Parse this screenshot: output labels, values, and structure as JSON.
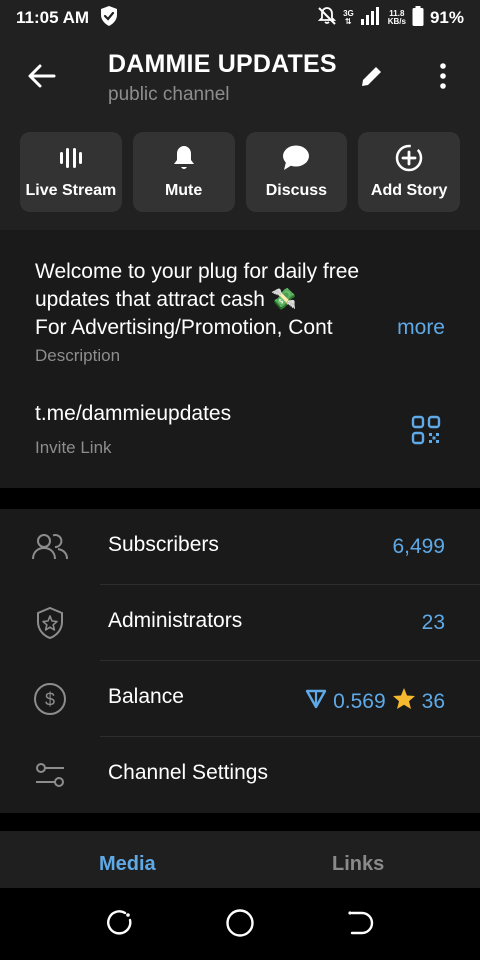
{
  "status_bar": {
    "time": "11:05 AM",
    "network": "3G",
    "speed_value": "11.8",
    "speed_unit": "KB/s",
    "battery": "91%"
  },
  "header": {
    "title": "DAMMIE UPDATES",
    "subtitle": "public channel"
  },
  "actions": [
    {
      "label": "Live Stream",
      "icon": "live-stream-icon"
    },
    {
      "label": "Mute",
      "icon": "bell-icon"
    },
    {
      "label": "Discuss",
      "icon": "chat-bubble-icon"
    },
    {
      "label": "Add Story",
      "icon": "add-story-icon"
    }
  ],
  "info": {
    "description_line1": "Welcome to your plug for daily free",
    "description_line2": "updates that attract cash 💸",
    "description_line3": "For Advertising/Promotion, Cont",
    "more": "more",
    "description_label": "Description",
    "link": "t.me/dammieupdates",
    "link_label": "Invite Link"
  },
  "rows": [
    {
      "label": "Subscribers",
      "value": "6,499",
      "icon": "people-icon"
    },
    {
      "label": "Administrators",
      "value": "23",
      "icon": "admin-shield-icon"
    },
    {
      "label": "Balance",
      "ton_value": "0.569",
      "stars_value": "36",
      "icon": "dollar-coin-icon"
    },
    {
      "label": "Channel Settings",
      "value": "",
      "icon": "settings-sliders-icon"
    }
  ],
  "tabs": {
    "media": "Media",
    "links": "Links"
  },
  "colors": {
    "accent": "#5ea9e6",
    "star": "#f5b82e",
    "header_bg": "#212121",
    "section_bg": "#1a1a1a"
  }
}
